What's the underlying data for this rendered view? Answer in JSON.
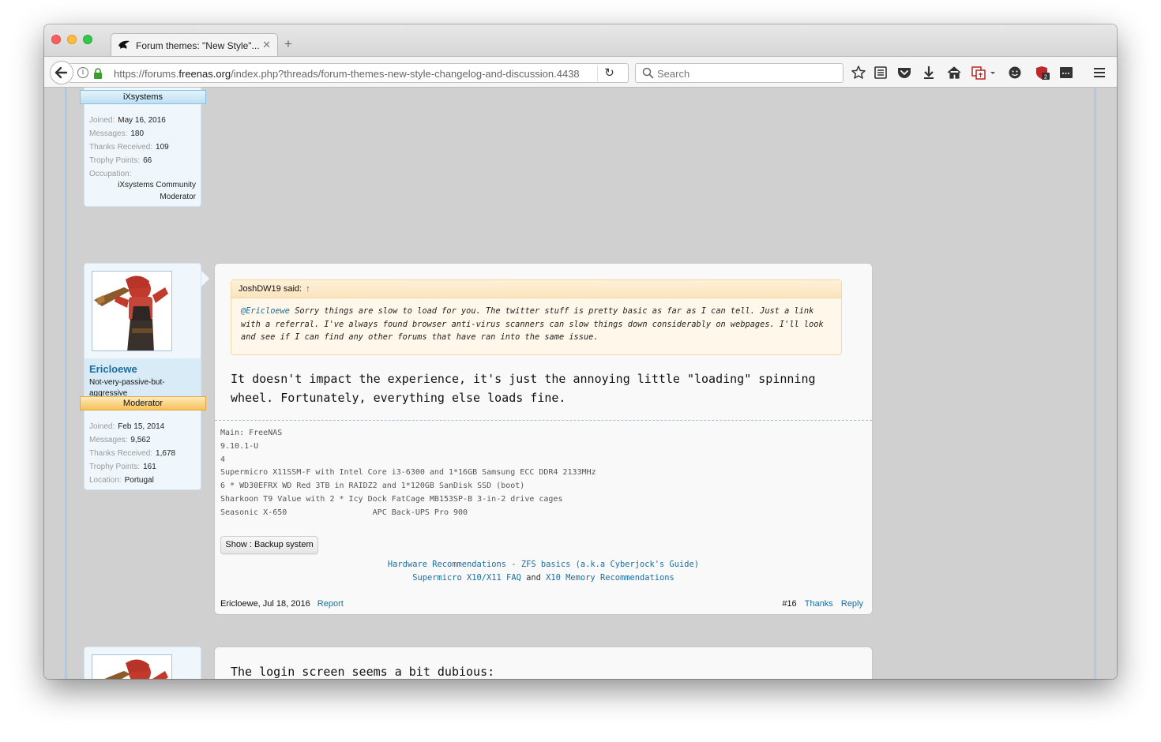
{
  "browser": {
    "tab_title": "Forum themes: \"New Style\"...",
    "tab_close": "✕",
    "new_tab": "+",
    "url_prefix": "https://forums.",
    "url_domain": "freenas.org",
    "url_rest": "/index.php?threads/forum-themes-new-style-changelog-and-discussion.4438",
    "search_placeholder": "Search",
    "reload": "↻",
    "info": "i"
  },
  "post_prev": {
    "ribbon": "iXsystems",
    "stats": [
      {
        "label": "Joined:",
        "value": "May 16, 2016"
      },
      {
        "label": "Messages:",
        "value": "180"
      },
      {
        "label": "Thanks Received:",
        "value": "109"
      },
      {
        "label": "Trophy Points:",
        "value": "66"
      }
    ],
    "occupation_label": "Occupation:",
    "occupation_value": "iXsystems Community Moderator"
  },
  "post16": {
    "username": "Ericloewe",
    "user_title": "Not-very-passive-but-aggressive",
    "ribbon": "Moderator",
    "stats": [
      {
        "label": "Joined:",
        "value": "Feb 15, 2014"
      },
      {
        "label": "Messages:",
        "value": "9,562"
      },
      {
        "label": "Thanks Received:",
        "value": "1,678"
      },
      {
        "label": "Trophy Points:",
        "value": "161"
      },
      {
        "label": "Location:",
        "value": "Portugal"
      }
    ],
    "quote_author": "JoshDW19 said:",
    "quote_arrow": "↑",
    "quote_mention": "@Ericloewe",
    "quote_text": " Sorry things are slow to load for you.  The twitter stuff is pretty basic as far as I can tell.  Just a link with a referral.  I've always found browser anti-virus scanners can slow things down considerably on webpages.  I'll look and see if I can find any other forums that have ran into the same issue.",
    "body": "It doesn't impact the experience, it's just the annoying little \"loading\" spinning wheel. Fortunately, everything else loads fine.",
    "signature": [
      "Main: FreeNAS",
      "9.10.1-U",
      "4",
      "Supermicro X11SSM-F with Intel Core i3-6300 and 1*16GB Samsung ECC DDR4 2133MHz",
      "6 * WD30EFRX WD Red 3TB in RAIDZ2 and 1*120GB SanDisk SSD (boot)",
      "Sharkoon T9 Value with 2 * Icy Dock FatCage MB153SP-B 3-in-2 drive cages",
      "Seasonic X-650                  APC Back-UPS Pro 900"
    ],
    "show_button": "Show : Backup system",
    "links": {
      "hardware": "Hardware Recommendations",
      "dash": " - ",
      "zfs": "ZFS basics (a.k.a Cyberjock's Guide)",
      "x10faq": "Supermicro X10/X11 FAQ",
      "and": " and ",
      "x10mem": "X10 Memory Recommendations"
    },
    "footer_author_date": "Ericloewe, Jul 18, 2016",
    "report": "Report",
    "post_number": "#16",
    "thanks": "Thanks",
    "reply": "Reply"
  },
  "post17": {
    "body": "The login screen seems a bit dubious:"
  }
}
